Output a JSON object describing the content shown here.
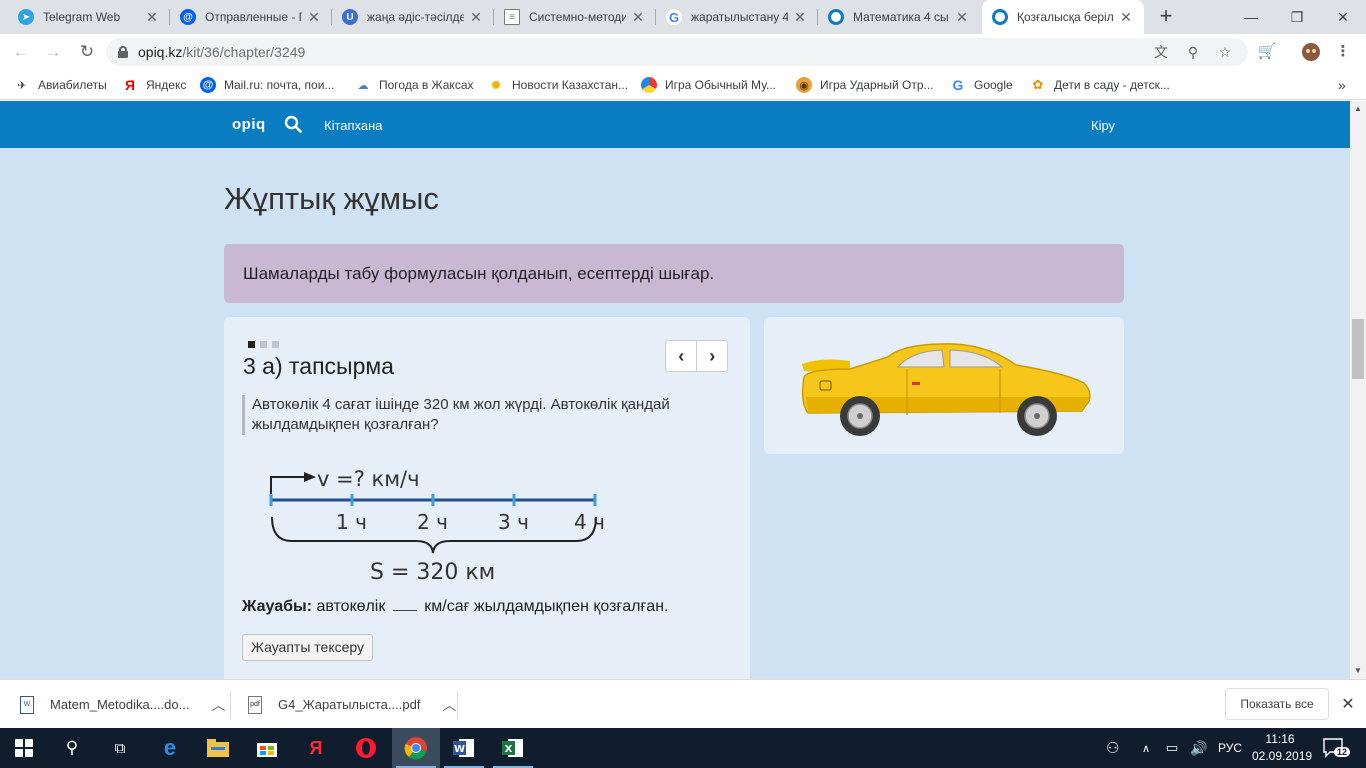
{
  "browser": {
    "tabs": [
      {
        "title": "Telegram Web",
        "icon": "telegram-icon",
        "color": "#2ca5e0"
      },
      {
        "title": "Отправленные - Г",
        "icon": "mailru-icon",
        "color": "#005ff9"
      },
      {
        "title": "жаңа әдіс-тәсілде",
        "icon": "ucoz-icon",
        "color": "#3a6fd8"
      },
      {
        "title": "Системно-методи",
        "icon": "document-icon",
        "color": "#7a7a7a"
      },
      {
        "title": "жаратылыстану 4",
        "icon": "google-icon",
        "color": "#4285f4"
      },
      {
        "title": "Математика 4 сы",
        "icon": "opiq-icon",
        "color": "#0a7cc2"
      },
      {
        "title": "Қозғалысқа берілі",
        "icon": "opiq-icon",
        "color": "#0a7cc2"
      }
    ],
    "url_host": "opiq.kz",
    "url_path": "/kit/36/chapter/3249",
    "bookmarks": [
      {
        "label": "Авиабилеты",
        "icon": "plane-icon"
      },
      {
        "label": "Яндекс",
        "icon": "yandex-icon"
      },
      {
        "label": "Mail.ru: почта, пои...",
        "icon": "mailru-icon"
      },
      {
        "label": "Погода в Жаксах",
        "icon": "weather-icon"
      },
      {
        "label": "Новости Казахстан...",
        "icon": "sun-icon"
      },
      {
        "label": "Игра Обычный Му...",
        "icon": "game-icon"
      },
      {
        "label": "Игра Ударный Отр...",
        "icon": "owl-icon"
      },
      {
        "label": "Google",
        "icon": "google-icon"
      },
      {
        "label": "Дети в саду - детск...",
        "icon": "kids-icon"
      }
    ]
  },
  "site": {
    "logo": "opiq",
    "library_link": "Кітапхана",
    "login_link": "Кіру"
  },
  "page": {
    "title": "Жұптық жұмыс",
    "instruction": "Шамаларды табу формуласын қолданып, есептерді шығар.",
    "task": {
      "title": "3 а) тапсырма",
      "text": "Автокөлік 4 сағат ішінде 320 км жол жүрді. Автокөлік қандай жылдамдықпен қозғалған?",
      "answer_label": "Жауабы:",
      "answer_before": "автокөлік",
      "answer_after": "км/сағ жылдамдықпен қозғалған.",
      "check_button": "Жауапты тексеру",
      "slides_total": 3,
      "slide_active": 1
    },
    "diagram": {
      "speed_label": "v =? км/ч",
      "ticks": [
        "1 ч",
        "2 ч",
        "3 ч",
        "4 ч"
      ],
      "distance_label": "S = 320 км"
    }
  },
  "downloads": {
    "items": [
      {
        "name": "Matem_Metodika....do..."
      },
      {
        "name": "G4_Жаратылыста....pdf"
      }
    ],
    "show_all": "Показать все"
  },
  "taskbar": {
    "lang": "РУС",
    "time": "11:16",
    "date": "02.09.2019",
    "notifications": "12"
  }
}
